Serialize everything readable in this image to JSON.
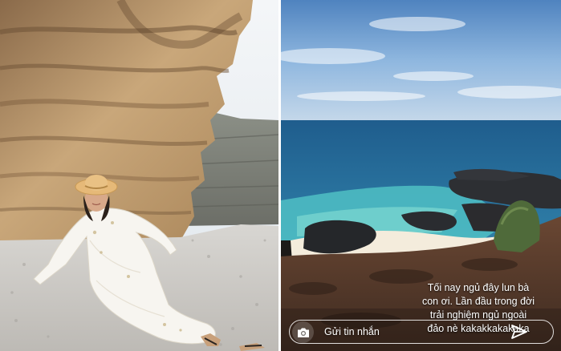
{
  "story": {
    "caption_lines": [
      "Tối nay ngủ đây lun bà",
      "con ơi. Lần đầu trong đời",
      "trải nghiệm ngủ ngoài",
      "đảo nè kakakkakakaka"
    ]
  },
  "reply_bar": {
    "placeholder": "Gửi tin nhắn",
    "camera_icon": "camera-icon",
    "send_icon": "paper-plane-icon"
  },
  "colors": {
    "sky": "#9fc3e4",
    "sea": "#2f6f9c",
    "lagoon": "#58c9c7",
    "sand": "#f4ecdc",
    "cliff": "#b9986e",
    "dress": "#f7f5f0",
    "hat": "#e6b978"
  }
}
